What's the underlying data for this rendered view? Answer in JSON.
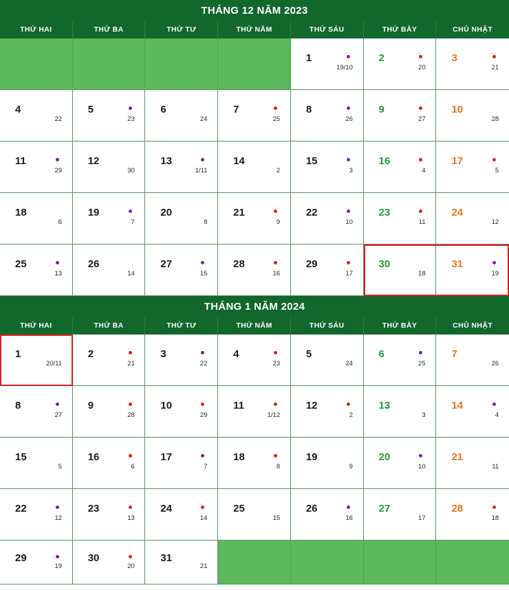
{
  "colors": {
    "header_green": "#11672c",
    "empty_green": "#5cb85c",
    "grid_green": "#5a8f5e",
    "saturday": "#1e9e2e",
    "sunday": "#e8741c",
    "dot_red": "#e01b1b",
    "dot_purple": "#7b1fa2",
    "highlight_red": "#e02020"
  },
  "weekday_labels": [
    "THỨ HAI",
    "THỨ BA",
    "THỨ TƯ",
    "THỨ NĂM",
    "THỨ SÁU",
    "THỨ BẢY",
    "CHỦ NHẬT"
  ],
  "months": [
    {
      "title": "THÁNG 12 NĂM 2023",
      "weeks": [
        [
          {
            "empty": true
          },
          {
            "empty": true
          },
          {
            "empty": true
          },
          {
            "empty": true
          },
          {
            "solar": "1",
            "lunar": "19/10",
            "dot": "purple",
            "kind": "weekday"
          },
          {
            "solar": "2",
            "lunar": "20",
            "dot": "red",
            "kind": "sat"
          },
          {
            "solar": "3",
            "lunar": "21",
            "dot": "red",
            "kind": "sun"
          }
        ],
        [
          {
            "solar": "4",
            "lunar": "22",
            "dot": "none",
            "kind": "weekday"
          },
          {
            "solar": "5",
            "lunar": "23",
            "dot": "purple",
            "kind": "weekday"
          },
          {
            "solar": "6",
            "lunar": "24",
            "dot": "none",
            "kind": "weekday"
          },
          {
            "solar": "7",
            "lunar": "25",
            "dot": "red",
            "kind": "weekday"
          },
          {
            "solar": "8",
            "lunar": "26",
            "dot": "purple",
            "kind": "weekday"
          },
          {
            "solar": "9",
            "lunar": "27",
            "dot": "red",
            "kind": "sat"
          },
          {
            "solar": "10",
            "lunar": "28",
            "dot": "none",
            "kind": "sun"
          }
        ],
        [
          {
            "solar": "11",
            "lunar": "29",
            "dot": "purple",
            "kind": "weekday"
          },
          {
            "solar": "12",
            "lunar": "30",
            "dot": "none",
            "kind": "weekday"
          },
          {
            "solar": "13",
            "lunar": "1/11",
            "dot": "purple",
            "kind": "weekday"
          },
          {
            "solar": "14",
            "lunar": "2",
            "dot": "none",
            "kind": "weekday"
          },
          {
            "solar": "15",
            "lunar": "3",
            "dot": "purple",
            "kind": "weekday"
          },
          {
            "solar": "16",
            "lunar": "4",
            "dot": "red",
            "kind": "sat"
          },
          {
            "solar": "17",
            "lunar": "5",
            "dot": "red",
            "kind": "sun"
          }
        ],
        [
          {
            "solar": "18",
            "lunar": "6",
            "dot": "none",
            "kind": "weekday"
          },
          {
            "solar": "19",
            "lunar": "7",
            "dot": "purple",
            "kind": "weekday"
          },
          {
            "solar": "20",
            "lunar": "8",
            "dot": "none",
            "kind": "weekday"
          },
          {
            "solar": "21",
            "lunar": "9",
            "dot": "red",
            "kind": "weekday"
          },
          {
            "solar": "22",
            "lunar": "10",
            "dot": "purple",
            "kind": "weekday"
          },
          {
            "solar": "23",
            "lunar": "11",
            "dot": "red",
            "kind": "sat"
          },
          {
            "solar": "24",
            "lunar": "12",
            "dot": "none",
            "kind": "sun"
          }
        ],
        [
          {
            "solar": "25",
            "lunar": "13",
            "dot": "purple",
            "kind": "weekday"
          },
          {
            "solar": "26",
            "lunar": "14",
            "dot": "none",
            "kind": "weekday"
          },
          {
            "solar": "27",
            "lunar": "15",
            "dot": "purple",
            "kind": "weekday"
          },
          {
            "solar": "28",
            "lunar": "16",
            "dot": "red",
            "kind": "weekday"
          },
          {
            "solar": "29",
            "lunar": "17",
            "dot": "red",
            "kind": "weekday"
          },
          {
            "solar": "30",
            "lunar": "18",
            "dot": "none",
            "kind": "sat",
            "highlight": "start"
          },
          {
            "solar": "31",
            "lunar": "19",
            "dot": "purple",
            "kind": "sun",
            "highlight": "end"
          }
        ]
      ]
    },
    {
      "title": "THÁNG 1 NĂM 2024",
      "weeks": [
        [
          {
            "solar": "1",
            "lunar": "20/11",
            "dot": "none",
            "kind": "weekday",
            "highlight": "single"
          },
          {
            "solar": "2",
            "lunar": "21",
            "dot": "red",
            "kind": "weekday"
          },
          {
            "solar": "3",
            "lunar": "22",
            "dot": "purple",
            "kind": "weekday"
          },
          {
            "solar": "4",
            "lunar": "23",
            "dot": "red",
            "kind": "weekday"
          },
          {
            "solar": "5",
            "lunar": "24",
            "dot": "none",
            "kind": "weekday"
          },
          {
            "solar": "6",
            "lunar": "25",
            "dot": "purple",
            "kind": "sat"
          },
          {
            "solar": "7",
            "lunar": "26",
            "dot": "none",
            "kind": "sun"
          }
        ],
        [
          {
            "solar": "8",
            "lunar": "27",
            "dot": "purple",
            "kind": "weekday"
          },
          {
            "solar": "9",
            "lunar": "28",
            "dot": "red",
            "kind": "weekday"
          },
          {
            "solar": "10",
            "lunar": "29",
            "dot": "red",
            "kind": "weekday"
          },
          {
            "solar": "11",
            "lunar": "1/12",
            "dot": "red",
            "kind": "weekday"
          },
          {
            "solar": "12",
            "lunar": "2",
            "dot": "red",
            "kind": "weekday"
          },
          {
            "solar": "13",
            "lunar": "3",
            "dot": "none",
            "kind": "sat"
          },
          {
            "solar": "14",
            "lunar": "4",
            "dot": "purple",
            "kind": "sun"
          }
        ],
        [
          {
            "solar": "15",
            "lunar": "5",
            "dot": "none",
            "kind": "weekday"
          },
          {
            "solar": "16",
            "lunar": "6",
            "dot": "red",
            "kind": "weekday"
          },
          {
            "solar": "17",
            "lunar": "7",
            "dot": "purple",
            "kind": "weekday"
          },
          {
            "solar": "18",
            "lunar": "8",
            "dot": "red",
            "kind": "weekday"
          },
          {
            "solar": "19",
            "lunar": "9",
            "dot": "none",
            "kind": "weekday"
          },
          {
            "solar": "20",
            "lunar": "10",
            "dot": "purple",
            "kind": "sat"
          },
          {
            "solar": "21",
            "lunar": "11",
            "dot": "none",
            "kind": "sun"
          }
        ],
        [
          {
            "solar": "22",
            "lunar": "12",
            "dot": "purple",
            "kind": "weekday"
          },
          {
            "solar": "23",
            "lunar": "13",
            "dot": "red",
            "kind": "weekday"
          },
          {
            "solar": "24",
            "lunar": "14",
            "dot": "red",
            "kind": "weekday"
          },
          {
            "solar": "25",
            "lunar": "15",
            "dot": "none",
            "kind": "weekday"
          },
          {
            "solar": "26",
            "lunar": "16",
            "dot": "purple",
            "kind": "weekday"
          },
          {
            "solar": "27",
            "lunar": "17",
            "dot": "none",
            "kind": "sat"
          },
          {
            "solar": "28",
            "lunar": "18",
            "dot": "red",
            "kind": "sun"
          }
        ],
        [
          {
            "solar": "29",
            "lunar": "19",
            "dot": "purple",
            "kind": "weekday"
          },
          {
            "solar": "30",
            "lunar": "20",
            "dot": "red",
            "kind": "weekday"
          },
          {
            "solar": "31",
            "lunar": "21",
            "dot": "none",
            "kind": "weekday"
          },
          {
            "empty": true
          },
          {
            "empty": true
          },
          {
            "empty": true
          },
          {
            "empty": true
          }
        ]
      ]
    }
  ]
}
